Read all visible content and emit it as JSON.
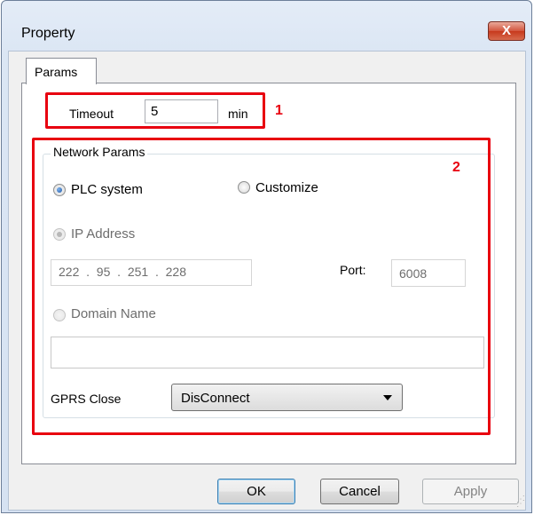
{
  "window": {
    "title": "Property",
    "close_label": "X"
  },
  "tabs": [
    {
      "label": "Params",
      "selected": true
    }
  ],
  "timeout": {
    "label": "Timeout",
    "value": "5",
    "unit": "min"
  },
  "network": {
    "group_title": "Network Params",
    "mode_plc_label": "PLC system",
    "mode_customize_label": "Customize",
    "selected_mode": "PLC system",
    "ip_address_label": "IP Address",
    "ip_value": "222  .  95  .  251  .  228",
    "port_label": "Port:",
    "port_value": "6008",
    "domain_name_label": "Domain Name",
    "domain_value": "",
    "gprs_close_label": "GPRS Close",
    "gprs_close_value": "DisConnect"
  },
  "annotations": {
    "box1_number": "1",
    "box2_number": "2",
    "color": "#e8000f"
  },
  "buttons": {
    "ok": "OK",
    "cancel": "Cancel",
    "apply": "Apply"
  }
}
